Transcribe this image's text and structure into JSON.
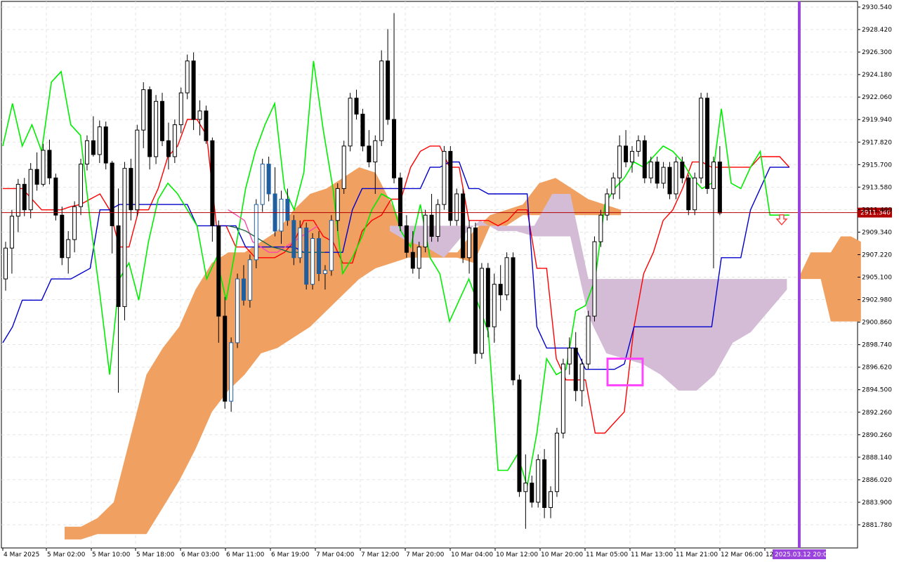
{
  "chart_data": {
    "type": "candlestick",
    "title": "",
    "xlabel": "",
    "ylabel": "",
    "ylim": [
      2879.8,
      2931.2
    ],
    "grid": true,
    "x_tick_labels": [
      "4 Mar 2025",
      "5 Mar 02:00",
      "5 Mar 10:00",
      "5 Mar 18:00",
      "6 Mar 03:00",
      "6 Mar 11:00",
      "6 Mar 19:00",
      "7 Mar 04:00",
      "7 Mar 12:00",
      "7 Mar 20:00",
      "10 Mar 04:00",
      "10 Mar 12:00",
      "10 Mar 20:00",
      "11 Mar 05:00",
      "11 Mar 13:00",
      "11 Mar 21:00",
      "12 Mar 06:00",
      "12"
    ],
    "y_tick_labels": [
      "2930.540",
      "2928.420",
      "2926.300",
      "2924.180",
      "2922.060",
      "2919.940",
      "2917.820",
      "2915.700",
      "2913.580",
      "2911.460",
      "2909.340",
      "2907.220",
      "2905.100",
      "2902.980",
      "2900.860",
      "2898.740",
      "2896.620",
      "2894.500",
      "2892.260",
      "2890.260",
      "2888.140",
      "2886.020",
      "2883.900",
      "2881.780"
    ],
    "current_price": 2911.34,
    "current_price_label": "2911.340",
    "time_marker_label": "2025.03.12 20:00",
    "candles": [
      [
        2905.1,
        2908.6,
        2904.0,
        2908.0
      ],
      [
        2908.0,
        2911.6,
        2905.6,
        2911.0
      ],
      [
        2911.0,
        2914.5,
        2909.5,
        2914.0
      ],
      [
        2914.0,
        2914.6,
        2911.0,
        2911.6
      ],
      [
        2911.6,
        2916.0,
        2910.8,
        2915.4
      ],
      [
        2915.4,
        2917.0,
        2913.4,
        2914.0
      ],
      [
        2914.0,
        2917.8,
        2913.8,
        2917.2
      ],
      [
        2917.2,
        2918.2,
        2914.0,
        2914.6
      ],
      [
        2914.6,
        2915.0,
        2910.6,
        2911.1
      ],
      [
        2911.1,
        2911.9,
        2906.4,
        2907.1
      ],
      [
        2907.1,
        2909.6,
        2905.6,
        2908.8
      ],
      [
        2908.8,
        2912.4,
        2907.6,
        2911.9
      ],
      [
        2911.9,
        2916.4,
        2911.1,
        2915.9
      ],
      [
        2915.9,
        2918.6,
        2915.3,
        2918.1
      ],
      [
        2918.1,
        2920.4,
        2916.6,
        2916.8
      ],
      [
        2916.8,
        2920.0,
        2916.0,
        2919.4
      ],
      [
        2919.4,
        2919.9,
        2915.4,
        2916.0
      ],
      [
        2916.0,
        2916.2,
        2907.5,
        2910.1
      ],
      [
        2910.1,
        2913.6,
        2894.4,
        2902.5
      ],
      [
        2902.5,
        2916.1,
        2901.2,
        2915.5
      ],
      [
        2915.5,
        2916.4,
        2910.6,
        2911.6
      ],
      [
        2911.6,
        2919.6,
        2911.0,
        2919.1
      ],
      [
        2919.1,
        2923.6,
        2917.4,
        2922.9
      ],
      [
        2922.9,
        2923.2,
        2915.4,
        2916.6
      ],
      [
        2916.6,
        2922.4,
        2915.9,
        2921.8
      ],
      [
        2921.8,
        2922.6,
        2917.6,
        2918.1
      ],
      [
        2918.1,
        2919.8,
        2915.4,
        2916.6
      ],
      [
        2916.6,
        2920.1,
        2916.0,
        2919.6
      ],
      [
        2919.6,
        2923.1,
        2918.8,
        2922.6
      ],
      [
        2922.6,
        2926.2,
        2922.0,
        2925.6
      ],
      [
        2925.6,
        2926.4,
        2919.1,
        2920.1
      ],
      [
        2920.1,
        2921.9,
        2918.6,
        2920.9
      ],
      [
        2920.9,
        2921.4,
        2917.8,
        2918.1
      ],
      [
        2918.1,
        2918.4,
        2908.6,
        2910.1
      ],
      [
        2910.1,
        2910.6,
        2899.1,
        2901.6
      ],
      [
        2901.6,
        2903.4,
        2892.9,
        2893.6
      ],
      [
        2893.6,
        2899.6,
        2892.6,
        2899.1
      ],
      [
        2899.1,
        2905.6,
        2898.6,
        2905.1
      ],
      [
        2905.1,
        2906.4,
        2902.6,
        2903.1
      ],
      [
        2903.1,
        2907.4,
        2902.4,
        2906.9
      ],
      [
        2906.9,
        2912.6,
        2906.1,
        2912.1
      ],
      [
        2912.1,
        2916.4,
        2911.4,
        2915.9
      ],
      [
        2915.9,
        2916.6,
        2912.4,
        2913.1
      ],
      [
        2913.1,
        2915.6,
        2909.1,
        2909.6
      ],
      [
        2909.6,
        2913.4,
        2908.4,
        2912.6
      ],
      [
        2912.6,
        2913.6,
        2910.1,
        2910.6
      ],
      [
        2910.6,
        2911.1,
        2906.4,
        2907.1
      ],
      [
        2907.1,
        2910.6,
        2906.6,
        2909.9
      ],
      [
        2909.9,
        2910.4,
        2904.1,
        2904.6
      ],
      [
        2904.6,
        2909.4,
        2904.1,
        2908.9
      ],
      [
        2908.9,
        2909.6,
        2904.9,
        2905.6
      ],
      [
        2905.6,
        2906.4,
        2904.1,
        2905.9
      ],
      [
        2905.9,
        2911.1,
        2905.4,
        2910.6
      ],
      [
        2910.6,
        2914.1,
        2909.6,
        2913.6
      ],
      [
        2913.6,
        2918.1,
        2913.1,
        2917.6
      ],
      [
        2917.6,
        2922.6,
        2917.1,
        2922.1
      ],
      [
        2922.1,
        2922.9,
        2920.1,
        2920.6
      ],
      [
        2920.6,
        2921.1,
        2917.1,
        2917.6
      ],
      [
        2917.6,
        2919.1,
        2915.6,
        2916.1
      ],
      [
        2916.1,
        2918.6,
        2913.1,
        2918.1
      ],
      [
        2918.1,
        2926.6,
        2917.6,
        2925.6
      ],
      [
        2925.6,
        2928.6,
        2919.6,
        2920.1
      ],
      [
        2920.1,
        2930.1,
        2914.1,
        2914.6
      ],
      [
        2914.6,
        2915.1,
        2909.6,
        2910.1
      ],
      [
        2910.1,
        2911.1,
        2907.1,
        2907.6
      ],
      [
        2907.6,
        2909.6,
        2905.6,
        2906.1
      ],
      [
        2906.1,
        2908.6,
        2905.1,
        2908.1
      ],
      [
        2908.1,
        2911.6,
        2907.6,
        2911.1
      ],
      [
        2911.1,
        2913.1,
        2908.6,
        2909.1
      ],
      [
        2909.1,
        2912.6,
        2908.6,
        2912.1
      ],
      [
        2912.1,
        2917.6,
        2911.6,
        2917.1
      ],
      [
        2917.1,
        2917.6,
        2910.1,
        2910.6
      ],
      [
        2910.6,
        2913.6,
        2910.1,
        2913.1
      ],
      [
        2913.1,
        2913.6,
        2906.6,
        2907.1
      ],
      [
        2907.1,
        2910.6,
        2905.6,
        2909.9
      ],
      [
        2909.9,
        2910.4,
        2897.1,
        2898.1
      ],
      [
        2898.1,
        2906.6,
        2897.6,
        2906.1
      ],
      [
        2906.1,
        2906.6,
        2899.6,
        2900.6
      ],
      [
        2900.6,
        2905.6,
        2899.1,
        2904.6
      ],
      [
        2904.6,
        2906.4,
        2902.1,
        2903.6
      ],
      [
        2903.6,
        2907.6,
        2903.1,
        2907.1
      ],
      [
        2907.1,
        2907.6,
        2895.1,
        2895.6
      ],
      [
        2895.6,
        2896.1,
        2884.6,
        2885.1
      ],
      [
        2885.1,
        2888.6,
        2881.6,
        2885.9
      ],
      [
        2885.9,
        2886.6,
        2883.6,
        2884.1
      ],
      [
        2884.1,
        2888.6,
        2883.6,
        2888.1
      ],
      [
        2888.1,
        2889.1,
        2882.6,
        2883.6
      ],
      [
        2883.6,
        2885.6,
        2882.6,
        2885.1
      ],
      [
        2885.1,
        2891.1,
        2884.6,
        2890.6
      ],
      [
        2890.6,
        2897.6,
        2890.1,
        2897.1
      ],
      [
        2897.1,
        2899.6,
        2896.1,
        2898.6
      ],
      [
        2898.6,
        2900.1,
        2893.6,
        2894.6
      ],
      [
        2894.6,
        2897.6,
        2893.1,
        2897.1
      ],
      [
        2897.1,
        2902.1,
        2896.6,
        2901.6
      ],
      [
        2901.6,
        2909.1,
        2901.1,
        2908.6
      ],
      [
        2908.6,
        2911.6,
        2908.1,
        2911.1
      ],
      [
        2911.1,
        2913.6,
        2910.6,
        2913.1
      ],
      [
        2913.1,
        2915.1,
        2912.6,
        2914.6
      ],
      [
        2914.6,
        2918.6,
        2912.6,
        2917.6
      ],
      [
        2917.6,
        2919.1,
        2915.6,
        2916.1
      ],
      [
        2916.1,
        2917.6,
        2915.1,
        2917.1
      ],
      [
        2917.1,
        2918.6,
        2916.6,
        2918.1
      ],
      [
        2918.1,
        2918.6,
        2914.1,
        2914.6
      ],
      [
        2914.6,
        2916.6,
        2914.1,
        2916.1
      ],
      [
        2916.1,
        2916.6,
        2913.6,
        2914.1
      ],
      [
        2914.1,
        2916.1,
        2913.6,
        2915.6
      ],
      [
        2915.6,
        2916.1,
        2912.6,
        2913.1
      ],
      [
        2913.1,
        2916.6,
        2912.6,
        2916.1
      ],
      [
        2916.1,
        2916.6,
        2914.1,
        2914.6
      ],
      [
        2914.6,
        2914.9,
        2911.1,
        2911.6
      ],
      [
        2911.6,
        2915.1,
        2911.1,
        2914.6
      ],
      [
        2914.6,
        2922.6,
        2914.1,
        2922.1
      ],
      [
        2922.1,
        2922.6,
        2913.1,
        2913.6
      ],
      [
        2913.6,
        2916.6,
        2906.1,
        2916.1
      ],
      [
        2916.1,
        2917.6,
        2911.1,
        2911.3
      ]
    ],
    "series": [
      {
        "name": "",
        "color": "#ff0000",
        "values": [
          2913.6,
          2913.6,
          2913.6,
          2912.6,
          2911.6,
          2911.6,
          2911.6,
          2911.9,
          2912.1,
          2912.6,
          2913.1,
          2911.6,
          2908.1,
          2908.1,
          2911.6,
          2911.6,
          2913.6,
          2916.6,
          2917.6,
          2920.1,
          2920.1,
          2918.6,
          2910.1,
          2910.1,
          2908.1,
          2908.1,
          2907.1,
          2907.1,
          2907.1,
          2907.6,
          2908.6,
          2910.6,
          2910.6,
          2909.1,
          2908.6,
          2906.6,
          2906.6,
          2909.6,
          2910.6,
          2911.1,
          2912.6,
          2912.6,
          2915.6,
          2917.1,
          2917.6,
          2917.6,
          2915.6,
          2915.6,
          2910.6,
          2910.6,
          2910.6,
          2910.1,
          2910.6,
          2911.6,
          2911.6,
          2906.1,
          2906.1,
          2897.6,
          2895.6,
          2895.6,
          2895.6,
          2890.6,
          2890.6,
          2891.6,
          2892.6,
          2900.6,
          2905.6,
          2907.6,
          2910.6,
          2911.6,
          2913.6,
          2916.1,
          2916.1,
          2915.6,
          2915.6,
          2915.6,
          2915.6,
          2915.6,
          2916.6,
          2916.6,
          2916.6,
          2915.6
        ]
      },
      {
        "name": "",
        "color": "#0000cc",
        "values": [
          2899.1,
          2900.6,
          2903.1,
          2903.1,
          2903.1,
          2905.1,
          2905.1,
          2905.1,
          2905.6,
          2906.1,
          2911.6,
          2911.6,
          2912.1,
          2912.1,
          2912.1,
          2912.1,
          2912.1,
          2912.1,
          2912.1,
          2912.1,
          2910.1,
          2910.1,
          2910.1,
          2910.1,
          2910.1,
          2908.1,
          2908.1,
          2908.1,
          2908.1,
          2908.1,
          2908.1,
          2907.6,
          2907.6,
          2907.6,
          2907.6,
          2907.6,
          2911.6,
          2913.6,
          2913.6,
          2913.6,
          2913.6,
          2913.6,
          2913.6,
          2913.6,
          2915.6,
          2915.6,
          2916.1,
          2916.1,
          2913.6,
          2913.6,
          2913.1,
          2913.1,
          2913.1,
          2913.1,
          2913.1,
          2900.6,
          2898.6,
          2898.6,
          2898.6,
          2898.6,
          2896.6,
          2896.6,
          2896.6,
          2896.6,
          2897.1,
          2900.6,
          2900.6,
          2900.6,
          2900.6,
          2900.6,
          2900.6,
          2900.6,
          2900.6,
          2900.6,
          2907.1,
          2907.1,
          2907.1,
          2911.6,
          2913.6,
          2915.6,
          2915.6,
          2915.6
        ]
      },
      {
        "name": "",
        "color": "#00ee00",
        "values": [
          2917.6,
          2921.6,
          2917.6,
          2919.6,
          2917.1,
          2923.6,
          2924.6,
          2919.6,
          2918.6,
          2910.6,
          2903.6,
          2896.1,
          2905.1,
          2906.6,
          2903.1,
          2908.6,
          2912.6,
          2914.1,
          2913.1,
          2911.6,
          2910.1,
          2905.1,
          2907.1,
          2903.1,
          2908.1,
          2913.6,
          2917.1,
          2919.6,
          2921.6,
          2913.6,
          2911.6,
          2915.1,
          2925.6,
          2919.1,
          2913.6,
          2905.6,
          2907.1,
          2909.1,
          2911.6,
          2913.1,
          2912.6,
          2909.6,
          2908.1,
          2912.1,
          2907.1,
          2905.6,
          2901.1,
          2903.1,
          2905.1,
          2902.6,
          2900.1,
          2887.1,
          2887.1,
          2888.6,
          2885.6,
          2890.6,
          2897.6,
          2896.1,
          2896.6,
          2902.1,
          2902.6,
          2905.1,
          2912.1,
          2913.6,
          2914.6,
          2916.1,
          2915.6,
          2916.6,
          2917.6,
          2917.1,
          2916.1,
          2914.6,
          2913.6,
          2914.1,
          2921.1,
          2914.1,
          2913.6,
          2915.6,
          2917.1,
          2911.1,
          2911.1,
          2911.1
        ]
      },
      {
        "name": "",
        "color": "#ff44aa",
        "values": [
          2911.6,
          2911.1,
          2910.6,
          2908.6,
          2908.1,
          2907.6,
          2907.6,
          2908.1,
          2908.6,
          2909.1,
          2909.6,
          2910.1
        ]
      },
      {
        "name": "",
        "color": "#226644",
        "values": [
          2910.1,
          2909.9,
          2909.6,
          2909.1,
          2908.6,
          2908.1,
          2907.9,
          2907.6,
          2907.6,
          2907.6,
          2907.6,
          2907.6
        ]
      }
    ],
    "cloud_bullish": {
      "color": "#f0a060",
      "upper": [
        2881.8,
        2881.8,
        2882.6,
        2884.1,
        2890.1,
        2896.1,
        2898.6,
        2900.6,
        2904.1,
        2906.6,
        2907.6,
        2907.6,
        2908.6,
        2909.6,
        2911.6,
        2913.1,
        2913.6,
        2914.6,
        2915.6,
        2915.1,
        2912.1,
        2909.1,
        2908.1,
        2907.6,
        2907.6,
        2909.6,
        2911.1,
        2911.6,
        2912.1,
        2914.1,
        2914.6,
        2913.6,
        2912.6,
        2912.1,
        2911.6
      ],
      "lower": [
        2880.6,
        2880.6,
        2881.1,
        2881.1,
        2881.1,
        2881.1,
        2883.6,
        2886.1,
        2889.1,
        2892.6,
        2894.6,
        2896.1,
        2898.1,
        2898.6,
        2899.6,
        2900.6,
        2902.1,
        2903.6,
        2905.1,
        2906.1,
        2906.6,
        2907.1,
        2907.1,
        2907.1,
        2907.1,
        2906.6,
        2910.1,
        2910.1,
        2911.1,
        2911.1,
        2911.1,
        2911.1,
        2911.1,
        2911.1,
        2911.1
      ]
    },
    "cloud_bearish": {
      "color": "#d4bcd6",
      "upper": [
        2910.1,
        2910.1,
        2910.1,
        2910.1,
        2910.1,
        2910.1,
        2910.1,
        2910.1,
        2910.1,
        2913.1,
        2913.1,
        2905.1,
        2905.1,
        2905.1,
        2905.1,
        2905.1,
        2905.1,
        2905.1,
        2905.1,
        2905.1,
        2905.1,
        2905.1,
        2905.1
      ],
      "lower": [
        2909.6,
        2908.6,
        2908.1,
        2907.1,
        2909.1,
        2910.6,
        2909.6,
        2909.6,
        2909.1,
        2909.1,
        2909.1,
        2901.6,
        2898.1,
        2897.6,
        2897.1,
        2896.1,
        2894.6,
        2894.6,
        2896.1,
        2899.1,
        2900.1,
        2902.1,
        2904.1
      ]
    },
    "cloud_future": {
      "color": "#f0a060",
      "upper": [
        2905.6,
        2907.6,
        2907.6,
        2907.6,
        2909.1,
        2909.1,
        2908.6
      ],
      "lower": [
        2905.1,
        2905.1,
        2905.1,
        2901.1,
        2901.1,
        2901.1,
        2901.1
      ]
    },
    "signal_arrow": {
      "direction": "down",
      "color": "#ff3b3b",
      "price": 2910.6
    },
    "highlight_box": {
      "color": "#ff44ff",
      "price_top": 2897.6,
      "price_bottom": 2895.1
    },
    "current_line_color": "#b00000",
    "time_marker_color": "#9a44dd"
  }
}
